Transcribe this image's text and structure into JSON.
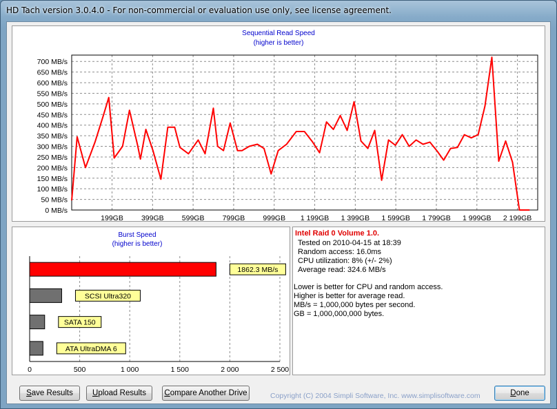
{
  "window": {
    "title": "HD Tach version 3.0.4.0  - For non-commercial or evaluation use only, see license agreement."
  },
  "sequential": {
    "title": "Sequential Read Speed",
    "subtitle": "(higher is better)"
  },
  "burst": {
    "title": "Burst Speed",
    "subtitle": "(higher is better)"
  },
  "chart_data": [
    {
      "type": "line",
      "title": "Sequential Read Speed",
      "subtitle": "(higher is better)",
      "ylabel": "",
      "xlabel": "",
      "y_unit": "MB/s",
      "ylim": [
        0,
        730
      ],
      "xlim": [
        0,
        2299
      ],
      "grid": true,
      "y_ticks": [
        "0 MB/s",
        "50 MB/s",
        "100 MB/s",
        "150 MB/s",
        "200 MB/s",
        "250 MB/s",
        "300 MB/s",
        "350 MB/s",
        "400 MB/s",
        "450 MB/s",
        "500 MB/s",
        "550 MB/s",
        "600 MB/s",
        "650 MB/s",
        "700 MB/s"
      ],
      "y_tick_values": [
        0,
        50,
        100,
        150,
        200,
        250,
        300,
        350,
        400,
        450,
        500,
        550,
        600,
        650,
        700
      ],
      "x_ticks": [
        "199GB",
        "399GB",
        "599GB",
        "799GB",
        "999GB",
        "1 199GB",
        "1 399GB",
        "1 599GB",
        "1 799GB",
        "1 999GB",
        "2 199GB"
      ],
      "x_tick_values": [
        199,
        399,
        599,
        799,
        999,
        1199,
        1399,
        1599,
        1799,
        1999,
        2199
      ],
      "series": [
        {
          "color": "#ff0000",
          "x": [
            0,
            27,
            68,
            115,
            156,
            183,
            210,
            251,
            285,
            325,
            339,
            366,
            401,
            440,
            474,
            508,
            534,
            576,
            624,
            658,
            699,
            720,
            749,
            782,
            818,
            840,
            876,
            916,
            949,
            984,
            1019,
            1060,
            1108,
            1148,
            1189,
            1223,
            1257,
            1291,
            1325,
            1359,
            1393,
            1427,
            1461,
            1495,
            1529,
            1563,
            1597,
            1631,
            1665,
            1699,
            1733,
            1767,
            1801,
            1835,
            1869,
            1903,
            1937,
            1971,
            2005,
            2039,
            2073,
            2107,
            2141,
            2175,
            2209,
            2242,
            2259
          ],
          "y": [
            45,
            345,
            200,
            320,
            445,
            530,
            245,
            300,
            470,
            305,
            240,
            380,
            280,
            145,
            390,
            390,
            295,
            265,
            330,
            265,
            480,
            300,
            280,
            410,
            280,
            280,
            300,
            310,
            290,
            170,
            280,
            310,
            370,
            370,
            320,
            270,
            415,
            380,
            445,
            375,
            510,
            325,
            290,
            375,
            140,
            330,
            305,
            355,
            300,
            330,
            310,
            320,
            280,
            235,
            290,
            295,
            355,
            340,
            355,
            490,
            720,
            230,
            325,
            225,
            0,
            0,
            0
          ]
        }
      ]
    },
    {
      "type": "bar",
      "orientation": "horizontal",
      "title": "Burst Speed",
      "subtitle": "(higher is better)",
      "xlim": [
        0,
        2500
      ],
      "x_ticks": [
        "0",
        "500",
        "1 000",
        "1 500",
        "2 000",
        "2 500"
      ],
      "x_tick_values": [
        0,
        500,
        1000,
        1500,
        2000,
        2500
      ],
      "grid": true,
      "categories": [
        "",
        "SCSI Ultra320",
        "SATA 150",
        "ATA UltraDMA 6"
      ],
      "labels": [
        "1862.3 MB/s",
        "SCSI Ultra320",
        "SATA 150",
        "ATA UltraDMA 6"
      ],
      "values": [
        1862.3,
        320,
        150,
        133
      ],
      "colors": [
        "#ff0000",
        "#707070",
        "#707070",
        "#707070"
      ]
    }
  ],
  "info": {
    "drive_name": "Intel Raid 0 Volume 1.0.",
    "tested_on": "Tested on 2010-04-15 at 18:39",
    "random_access": "Random access: 16.0ms",
    "cpu_utilization": "CPU utilization: 8% (+/- 2%)",
    "average_read": "Average read: 324.6 MB/s",
    "note1": "Lower is better for CPU and random access.",
    "note2": "Higher is better for average read.",
    "note3": "MB/s = 1,000,000 bytes per second.",
    "note4": "GB = 1,000,000,000 bytes."
  },
  "buttons": {
    "save_prefix": "S",
    "save_rest": "ave Results",
    "upload_prefix": "U",
    "upload_rest": "pload Results",
    "compare_prefix": "C",
    "compare_rest": "ompare Another Drive",
    "done_prefix": "D",
    "done_rest": "one"
  },
  "footer": {
    "copyright": "Copyright (C) 2004 Simpli Software, Inc. www.simplisoftware.com"
  }
}
